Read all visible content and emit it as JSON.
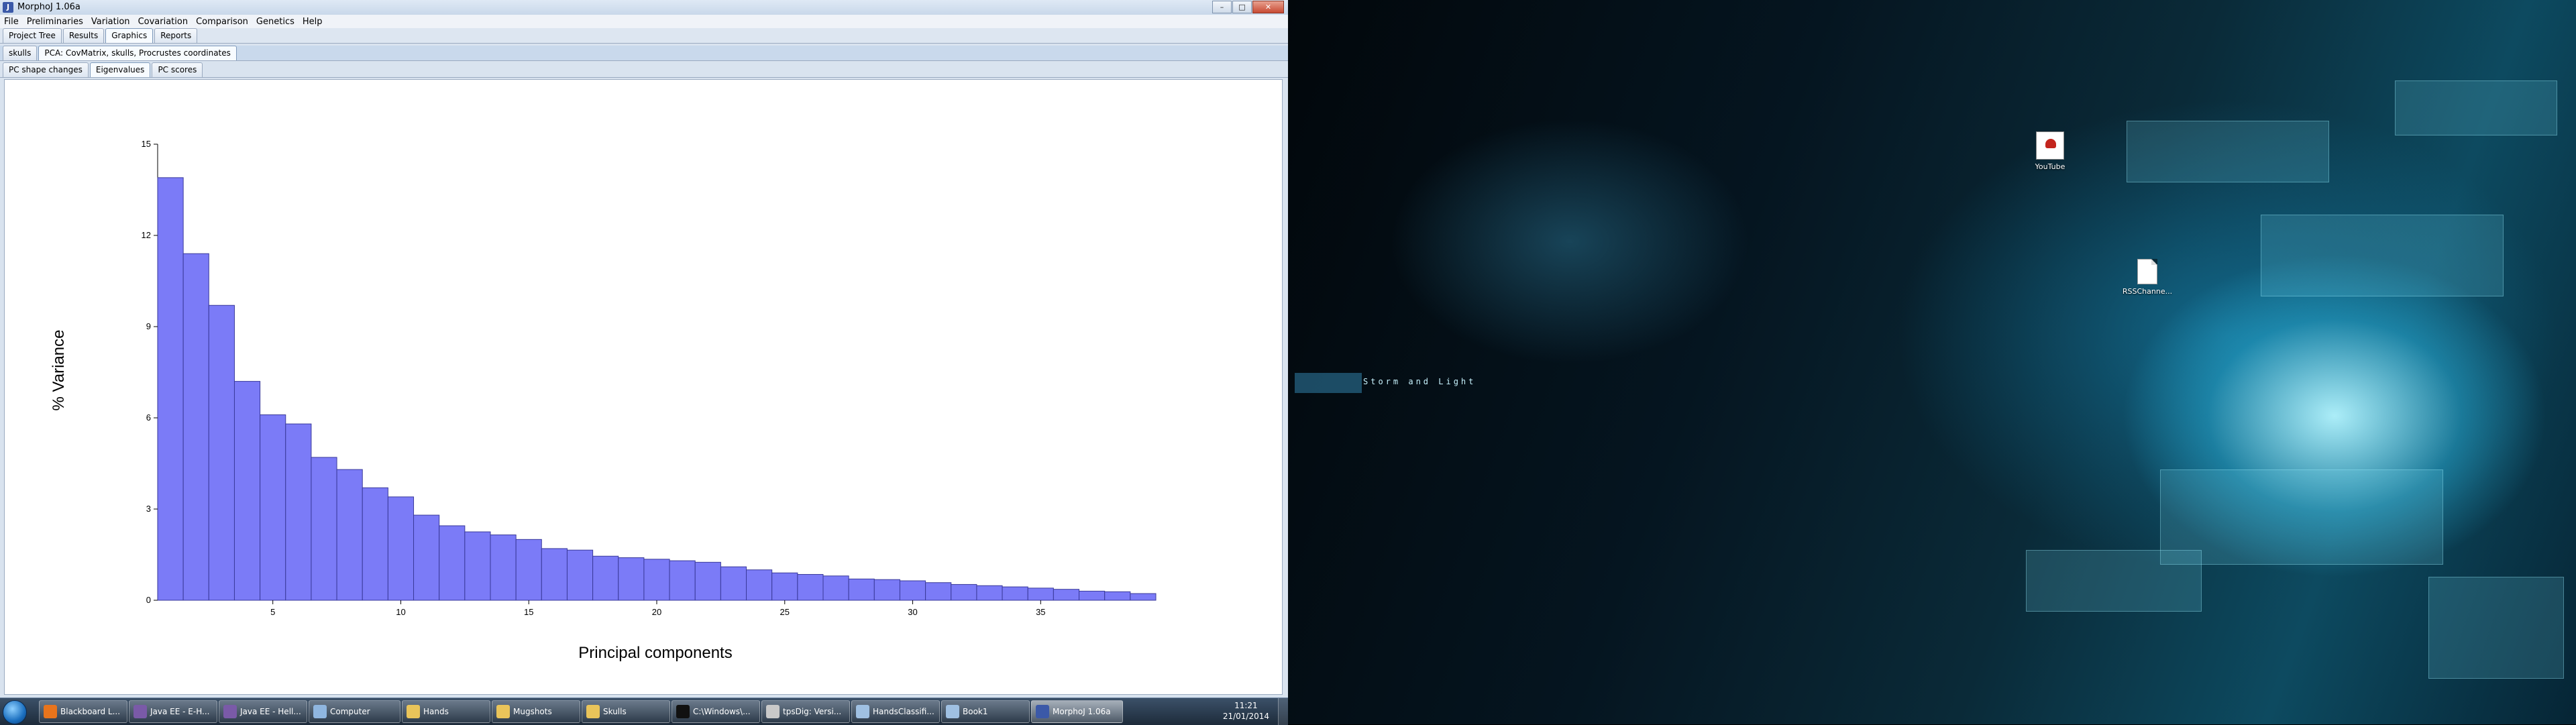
{
  "window": {
    "title": "MorphoJ 1.06a"
  },
  "window_controls": {
    "minimize": "–",
    "maximize": "□",
    "close": "✕"
  },
  "menu": [
    "File",
    "Preliminaries",
    "Variation",
    "Covariation",
    "Comparison",
    "Genetics",
    "Help"
  ],
  "main_tabs": [
    "Project Tree",
    "Results",
    "Graphics",
    "Reports"
  ],
  "dataset_tabs": [
    "skulls",
    "PCA: CovMatrix, skulls, Procrustes coordinates"
  ],
  "graph_tabs": [
    "PC shape changes",
    "Eigenvalues",
    "PC scores"
  ],
  "chart_data": {
    "type": "bar",
    "xlabel": "Principal components",
    "ylabel": "% Variance",
    "x_ticks": [
      5,
      10,
      15,
      20,
      25,
      30,
      35
    ],
    "y_ticks": [
      0,
      3,
      6,
      9,
      12,
      15
    ],
    "ylim": [
      0,
      15
    ],
    "xlim": [
      0.5,
      39.5
    ],
    "bar_color": "#7b7bf7",
    "categories": [
      1,
      2,
      3,
      4,
      5,
      6,
      7,
      8,
      9,
      10,
      11,
      12,
      13,
      14,
      15,
      16,
      17,
      18,
      19,
      20,
      21,
      22,
      23,
      24,
      25,
      26,
      27,
      28,
      29,
      30,
      31,
      32,
      33,
      34,
      35,
      36,
      37,
      38,
      39
    ],
    "values": [
      13.9,
      11.4,
      9.7,
      7.2,
      6.1,
      5.8,
      4.7,
      4.3,
      3.7,
      3.4,
      2.8,
      2.45,
      2.25,
      2.15,
      2.0,
      1.7,
      1.65,
      1.45,
      1.4,
      1.35,
      1.3,
      1.25,
      1.1,
      1.0,
      0.9,
      0.85,
      0.8,
      0.7,
      0.68,
      0.64,
      0.58,
      0.52,
      0.48,
      0.44,
      0.4,
      0.36,
      0.3,
      0.28,
      0.22,
      0.15
    ]
  },
  "taskbar": {
    "items": [
      {
        "label": "Blackboard L...",
        "icon": "firefox-icon",
        "color": "#e8741c"
      },
      {
        "label": "Java EE - E-H...",
        "icon": "eclipse-icon",
        "color": "#7a5aa8"
      },
      {
        "label": "Java EE - Hell...",
        "icon": "eclipse-icon",
        "color": "#7a5aa8"
      },
      {
        "label": "Computer",
        "icon": "computer-icon",
        "color": "#8fb6e0"
      },
      {
        "label": "Hands",
        "icon": "folder-icon",
        "color": "#e9c45a"
      },
      {
        "label": "Mugshots",
        "icon": "folder-icon",
        "color": "#e9c45a"
      },
      {
        "label": "Skulls",
        "icon": "folder-icon",
        "color": "#e9c45a"
      },
      {
        "label": "C:\\Windows\\...",
        "icon": "cmd-icon",
        "color": "#111111"
      },
      {
        "label": "tpsDig: Versi...",
        "icon": "tpsdig-icon",
        "color": "#c9c9c9"
      },
      {
        "label": "HandsClassifi...",
        "icon": "notepad-icon",
        "color": "#9fc0e2"
      },
      {
        "label": "Book1",
        "icon": "notepad-icon",
        "color": "#9fc0e2"
      },
      {
        "label": "MorphoJ 1.06a",
        "icon": "morphoj-icon",
        "color": "#3b59a8"
      }
    ],
    "clock_time": "11:21",
    "clock_date": "21/01/2014"
  },
  "desktop": {
    "wallpaper_caption": "Storm and Light",
    "icons": [
      {
        "label": "YouTube",
        "icon": "youtube-icon"
      },
      {
        "label": "RSSChanne...",
        "icon": "file-icon"
      }
    ]
  }
}
